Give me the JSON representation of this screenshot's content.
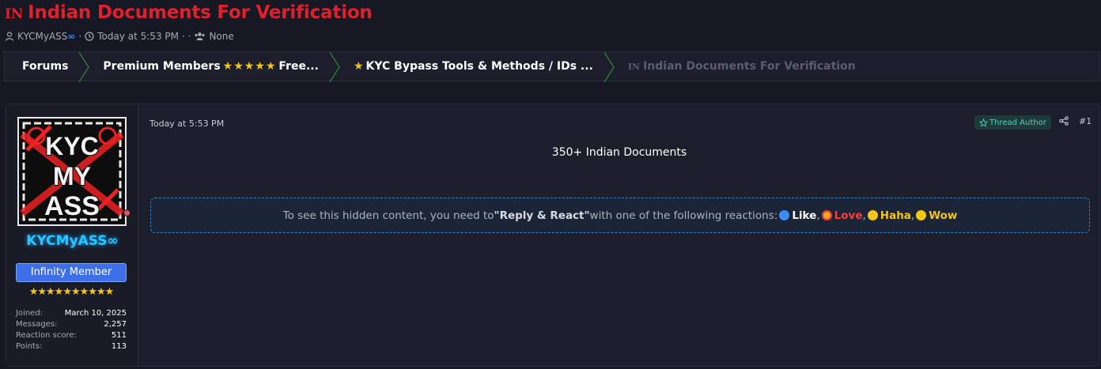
{
  "thread": {
    "flag": "IN",
    "title": "Indian Documents For Verification",
    "author": "KYCMyASS",
    "author_suffix": "∞",
    "time": "Today at 5:53 PM",
    "sep": "· ·",
    "prefix": "None"
  },
  "breadcrumb": {
    "forums": "Forums",
    "premium_a": "Premium Members",
    "premium_stars": "★★★★★",
    "premium_b": "Free...",
    "kyc": "KYC Bypass Tools & Methods / IDs ...",
    "current_flag": "IN",
    "current": "Indian Documents For Verification"
  },
  "post": {
    "username": "KYCMyASS∞",
    "rank": "Infinity Member",
    "rank_stars": "★★★★★★★★★★",
    "stats": [
      {
        "key": "Joined:",
        "value": "March 10, 2025"
      },
      {
        "key": "Messages:",
        "value": "2,257"
      },
      {
        "key": "Reaction score:",
        "value": "511"
      },
      {
        "key": "Points:",
        "value": "113"
      }
    ],
    "date": "Today at 5:53 PM",
    "author_badge": "Thread Author",
    "number": "#1",
    "content_title": "350+ Indian Documents",
    "hidden": {
      "lead": "To see this hidden content, you need to ",
      "bold": "\"Reply & React\"",
      "tail": " with one of the following reactions: ",
      "like": "Like",
      "love": "Love",
      "haha": "Haha",
      "wow": "Wow",
      "comma": ","
    }
  },
  "colors": {
    "accent_red": "#e0202c",
    "username_cyan": "#22c8ff",
    "rank_blue": "#3f6fe8",
    "star_gold": "#f5c518",
    "crumb_separator": "#2e7d32"
  },
  "avatar_text": [
    "KYC",
    "MY",
    "ASS"
  ]
}
